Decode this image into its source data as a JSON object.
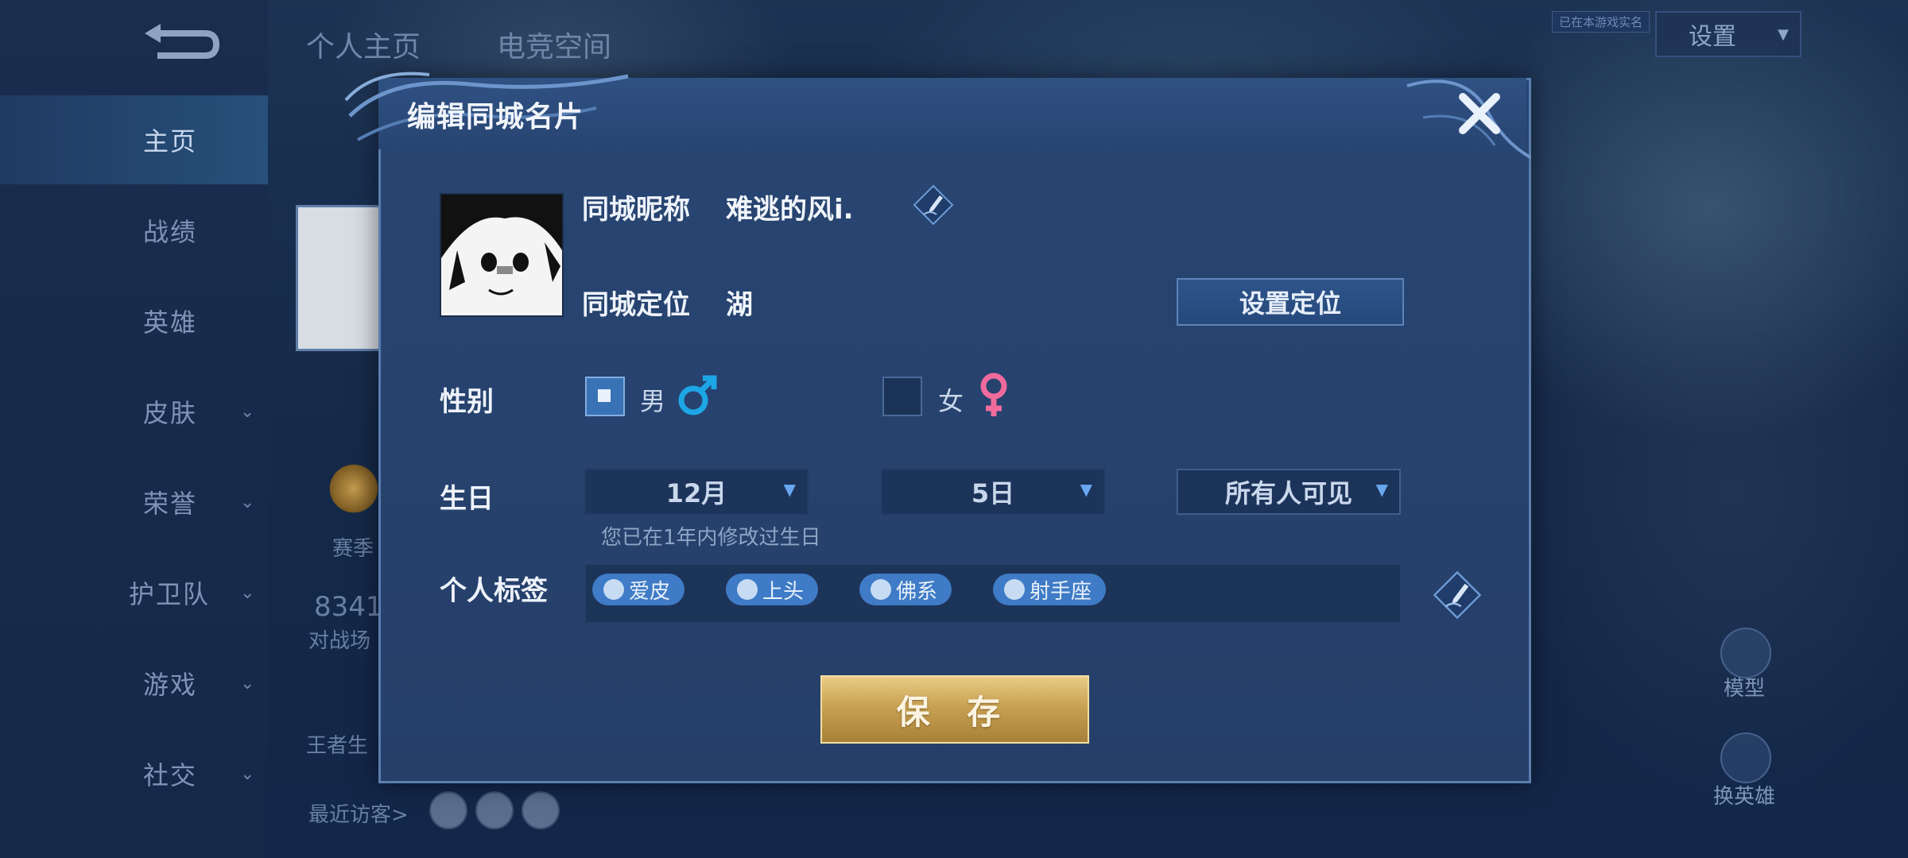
{
  "sidebar": {
    "items": [
      {
        "label": "主页",
        "active": true,
        "has_chevron": false
      },
      {
        "label": "战绩",
        "active": false,
        "has_chevron": false
      },
      {
        "label": "英雄",
        "active": false,
        "has_chevron": false
      },
      {
        "label": "皮肤",
        "active": false,
        "has_chevron": true
      },
      {
        "label": "荣誉",
        "active": false,
        "has_chevron": true
      },
      {
        "label": "护卫队",
        "active": false,
        "has_chevron": true
      },
      {
        "label": "游戏",
        "active": false,
        "has_chevron": true
      },
      {
        "label": "社交",
        "active": false,
        "has_chevron": true
      }
    ]
  },
  "top_tabs": [
    "个人主页",
    "电竞空间"
  ],
  "header": {
    "realname_tag": "已在本游戏实名",
    "settings_label": "设置"
  },
  "background_profile": {
    "season_text": "赛季",
    "score_text": "8341",
    "battle_text": "对战场",
    "king_text": "王者生",
    "recent_visitors": "最近访客>"
  },
  "right_panel": {
    "model_label": "模型",
    "change_hero_label": "换英雄"
  },
  "modal": {
    "title": "编辑同城名片",
    "nickname_label": "同城昵称",
    "nickname_value": "难逃的风i.",
    "location_label": "同城定位",
    "location_value": "湖",
    "set_location_button": "设置定位",
    "gender_label": "性别",
    "gender_male": "男",
    "gender_female": "女",
    "gender_selected": "male",
    "birthday_label": "生日",
    "birthday_month": "12月",
    "birthday_day": "5日",
    "birthday_visibility": "所有人可见",
    "birthday_hint": "您已在1年内修改过生日",
    "tags_label": "个人标签",
    "tags": [
      "爱皮",
      "上头",
      "佛系",
      "射手座"
    ],
    "save_button": "保 存"
  },
  "colors": {
    "modal_bg": "#284572",
    "accent_blue": "#3f7bc6",
    "save_gold": "#c8a152",
    "male_color": "#1da6e6",
    "female_color": "#f06b9c"
  }
}
